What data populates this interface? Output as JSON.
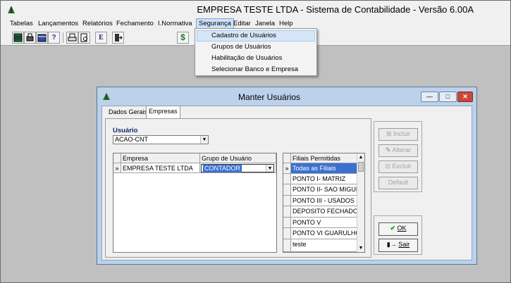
{
  "app": {
    "title": "EMPRESA TESTE LTDA - Sistema de Contabilidade - Versão 6.00A"
  },
  "menu": {
    "items": [
      "Tabelas",
      "Lançamentos",
      "Relatórios",
      "Fechamento",
      "I.Normativa",
      "Segurança",
      "Editar",
      "Janela",
      "Help"
    ],
    "open_menu": "Segurança",
    "dropdown": [
      "Cadastro de Usuários",
      "Grupos de Usuários",
      "Habilitação de Usuários",
      "Selecionar Banco e Empresa"
    ]
  },
  "toolbar": {
    "buttons": [
      "table-icon",
      "print-icon",
      "calendar-icon",
      "help-icon",
      "printer-icon",
      "print-preview-icon",
      "e-icon",
      "exit-icon",
      "dollar-icon"
    ],
    "e_glyph": "E",
    "dollar_glyph": "$",
    "help_glyph": "?"
  },
  "dialog": {
    "title": "Manter Usuários",
    "tabs": [
      "Dados Gerais",
      "Empresas"
    ],
    "active_tab": "Empresas",
    "usuario_label": "Usuário",
    "usuario_value": "ACAO-CNT",
    "grid": {
      "headers": [
        "Empresa",
        "Grupo de Usuário"
      ],
      "rows": [
        {
          "indicator": "»",
          "empresa": "EMPRESA TESTE LTDA",
          "grupo": "CONTADOR"
        }
      ]
    },
    "filiais": {
      "header": "Filiais Permitidas",
      "indicator": "»",
      "items": [
        "Todas as Filiais",
        "PONTO I- MATRIZ",
        "PONTO II- SAO MIGUEL",
        "PONTO III -  USADOS",
        "DEPOSITO FECHADO",
        "PONTO V",
        "PONTO VI GUARULHOS",
        "teste"
      ]
    },
    "buttons": {
      "incluir": "Incluir",
      "alterar": "Alterar",
      "excluir": "Excluir",
      "default": "Default",
      "ok": "OK",
      "sair": "Sair"
    }
  },
  "colors": {
    "selection": "#3a70d0",
    "dialog_frame": "#bcd2ea",
    "close_button": "#c9483a"
  }
}
